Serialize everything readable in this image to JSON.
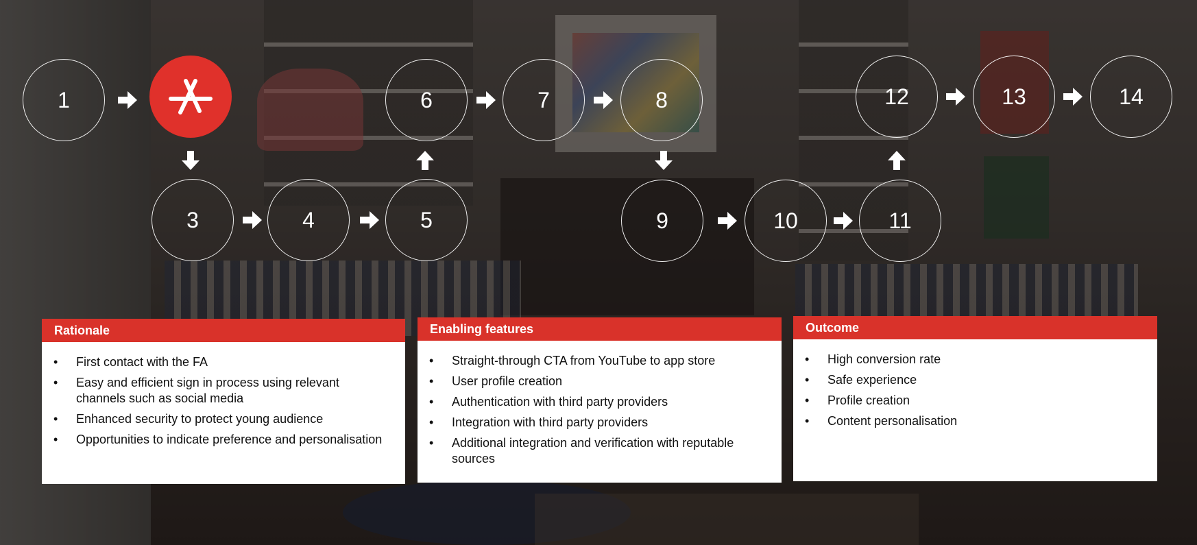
{
  "steps": [
    {
      "label": "1"
    },
    {
      "label": "",
      "icon": "app-store-icon"
    },
    {
      "label": "3"
    },
    {
      "label": "4"
    },
    {
      "label": "5"
    },
    {
      "label": "6"
    },
    {
      "label": "7"
    },
    {
      "label": "8"
    },
    {
      "label": "9"
    },
    {
      "label": "10"
    },
    {
      "label": "11"
    },
    {
      "label": "12"
    },
    {
      "label": "13"
    },
    {
      "label": "14"
    }
  ],
  "colors": {
    "accent": "#d9322a",
    "active_step": "#e0312b"
  },
  "panels": {
    "rationale": {
      "title": "Rationale",
      "items": [
        "First contact with the FA",
        "Easy and efficient sign in process using relevant channels such as social media",
        "Enhanced security to protect young audience",
        "Opportunities to indicate preference and personalisation"
      ]
    },
    "enabling": {
      "title": "Enabling features",
      "items": [
        "Straight-through CTA from YouTube to app store",
        "User profile creation",
        "Authentication with third party providers",
        "Integration with third party providers",
        "Additional integration and verification with reputable sources"
      ]
    },
    "outcome": {
      "title": "Outcome",
      "items": [
        "High conversion rate",
        "Safe experience",
        "Profile creation",
        "Content personalisation"
      ]
    }
  }
}
